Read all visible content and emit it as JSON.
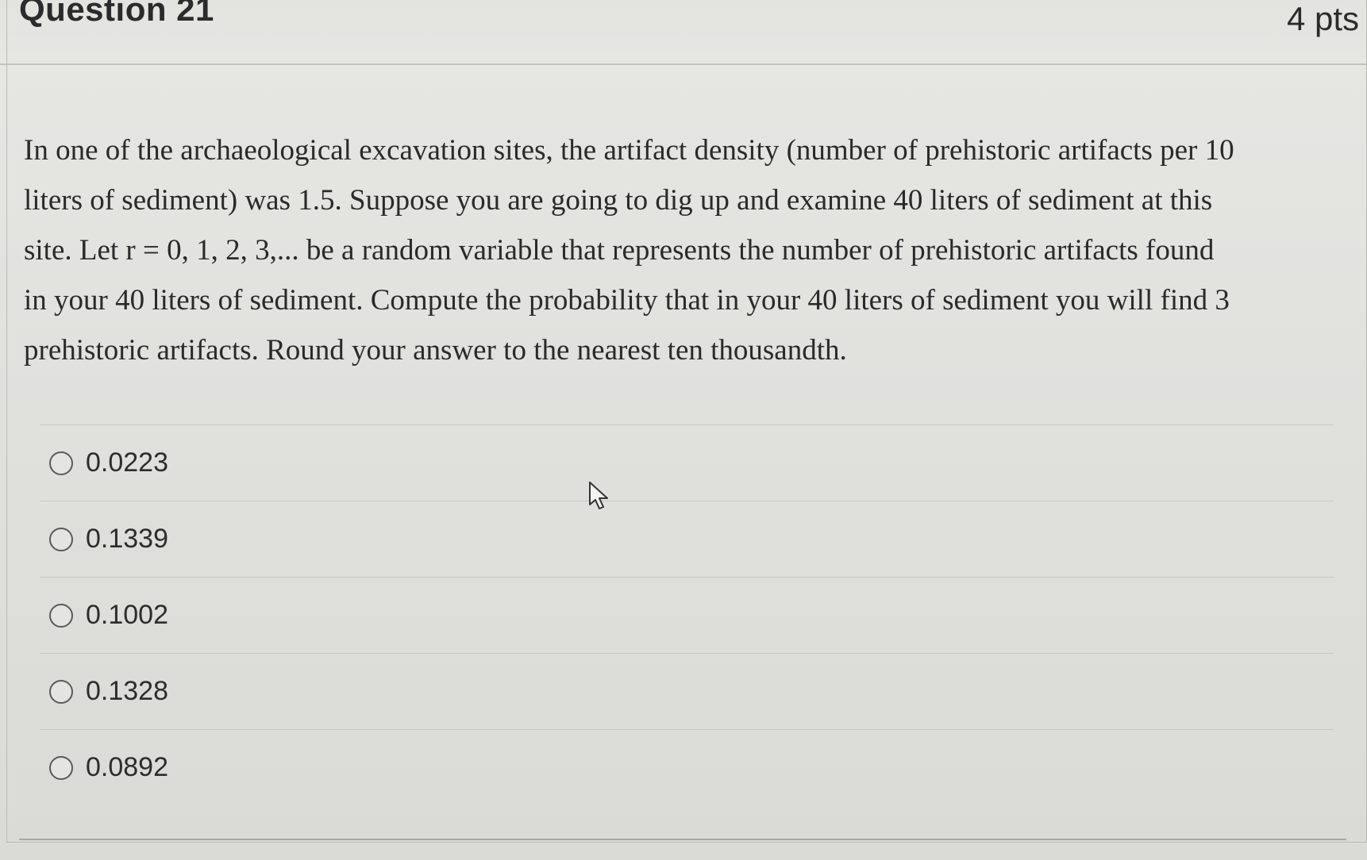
{
  "header": {
    "title": "Question 21",
    "points": "4 pts"
  },
  "question": {
    "lines": [
      "In one of the archaeological excavation sites, the artifact density (number of prehistoric artifacts per 10",
      "liters of sediment) was 1.5. Suppose you are going to dig up and examine 40 liters of sediment at this",
      "site. Let r = 0, 1, 2, 3,... be a random variable that represents the number of prehistoric artifacts found",
      "in your 40 liters of sediment. Compute the probability that in your 40 liters of sediment you will find 3",
      "prehistoric artifacts. Round your answer to the nearest ten thousandth."
    ]
  },
  "answers": [
    {
      "label": "0.0223"
    },
    {
      "label": "0.1339"
    },
    {
      "label": "0.1002"
    },
    {
      "label": "0.1328"
    },
    {
      "label": "0.0892"
    }
  ],
  "icons": {
    "cursor": "mouse-pointer-icon"
  }
}
